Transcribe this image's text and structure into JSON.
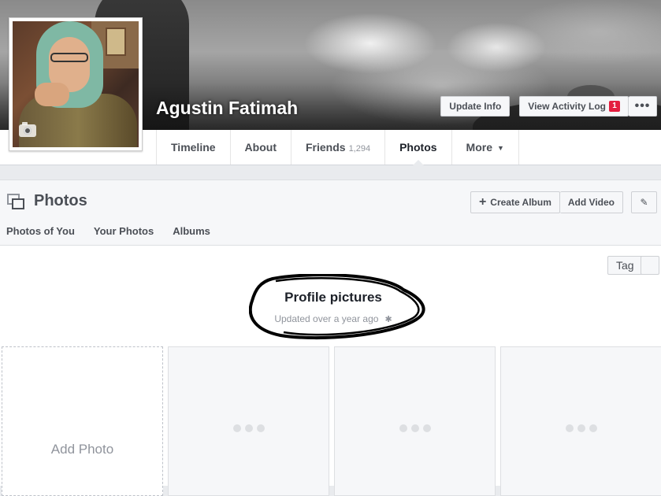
{
  "profile": {
    "name": "Agustin Fatimah",
    "cover_actions": {
      "update_info": "Update Info",
      "activity_log": "View Activity Log",
      "activity_badge": "1",
      "more_dots": "•••"
    }
  },
  "nav": {
    "tabs": [
      {
        "label": "Timeline"
      },
      {
        "label": "About"
      },
      {
        "label": "Friends",
        "count": "1,294"
      },
      {
        "label": "Photos",
        "active": true
      },
      {
        "label": "More",
        "caret": "▼"
      }
    ]
  },
  "photos": {
    "title": "Photos",
    "create_album": "Create Album",
    "create_album_icon": "+",
    "add_video": "Add Video",
    "edit_icon": "✎",
    "subtabs": [
      "Photos of You",
      "Your Photos",
      "Albums"
    ]
  },
  "album": {
    "tag_button": "Tag",
    "title": "Profile pictures",
    "updated": "Updated over a year ago",
    "settings_icon": "✱",
    "add_photo": "Add Photo"
  },
  "colors": {
    "badge": "#e41e3f",
    "page_bg": "#e9ebee",
    "header_bg": "#f6f7f9"
  }
}
